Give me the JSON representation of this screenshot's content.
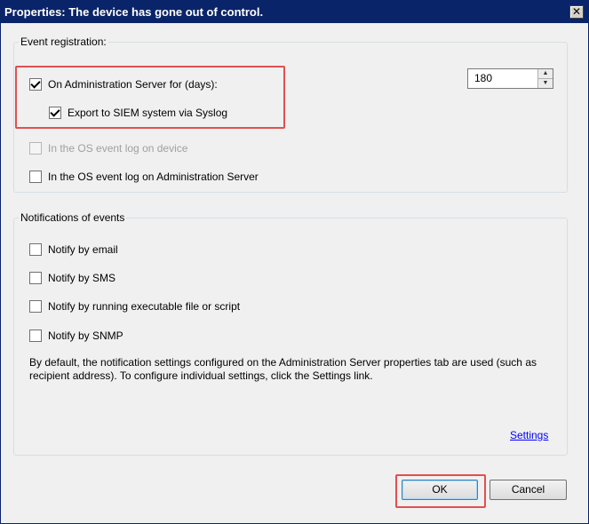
{
  "window": {
    "title": "Properties: The device has gone out of control.",
    "close_glyph": "✕"
  },
  "event_registration": {
    "group_label": "Event registration:",
    "admin_server": {
      "label": "On Administration Server for (days):",
      "checked": true
    },
    "days_value": "180",
    "siem": {
      "label": "Export to SIEM system via Syslog",
      "checked": true
    },
    "os_log_device": {
      "label": "In the OS event log on device",
      "checked": false,
      "disabled": true
    },
    "os_log_admin": {
      "label": "In the OS event log on Administration Server",
      "checked": false
    }
  },
  "notifications": {
    "group_label": "Notifications of events",
    "email": {
      "label": "Notify by email",
      "checked": false
    },
    "sms": {
      "label": "Notify by SMS",
      "checked": false
    },
    "exec": {
      "label": "Notify by running executable file or script",
      "checked": false
    },
    "snmp": {
      "label": "Notify by SNMP",
      "checked": false
    },
    "description": "By default, the notification settings configured on the Administration Server properties tab are used (such as recipient address). To configure individual settings, click the Settings link.",
    "settings_link": "Settings"
  },
  "buttons": {
    "ok": "OK",
    "cancel": "Cancel"
  },
  "colors": {
    "highlight": "#e05050",
    "titlebar": "#0a246a",
    "link": "#0000ff"
  },
  "icons": {
    "spin_up": "up-arrow-icon",
    "spin_down": "down-arrow-icon",
    "close": "close-icon"
  }
}
